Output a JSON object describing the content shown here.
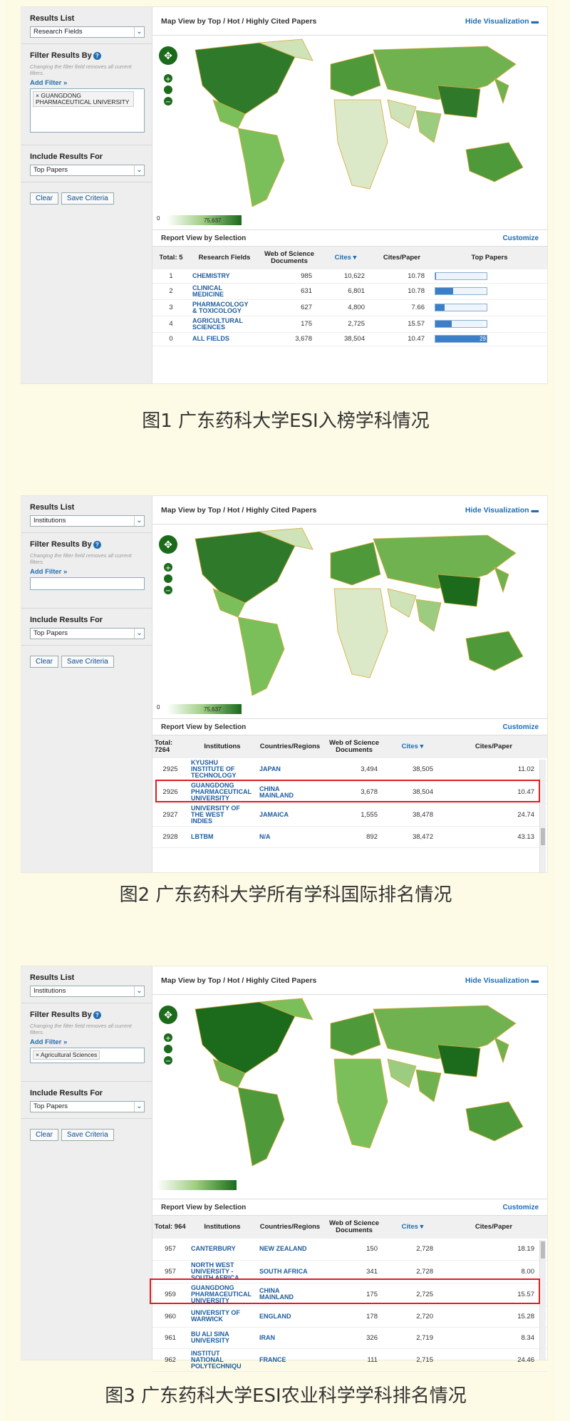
{
  "panels": [
    {
      "results_list": "Results List",
      "results_list_value": "Research Fields",
      "filter_title": "Filter Results By",
      "filter_note": "Changing the filter field removes all current filters.",
      "add_filter": "Add Filter »",
      "filter_tag": "GUANGDONG PHARMACEUTICAL UNIVERSITY",
      "include_title": "Include Results For",
      "include_value": "Top Papers",
      "clear": "Clear",
      "save": "Save Criteria",
      "map_title": "Map View by Top / Hot / Highly Cited Papers",
      "hide": "Hide Visualization",
      "legend_min": "0",
      "legend_max": "75,637",
      "report_title": "Report View by Selection",
      "customize": "Customize",
      "headers": [
        "Total: 5",
        "Research Fields",
        "Web of Science Documents",
        "Cites ▾",
        "Cites/Paper",
        "Top Papers"
      ],
      "rows": [
        {
          "rank": "1",
          "name": "CHEMISTRY",
          "docs": "985",
          "cites": "10,622",
          "cpp": "10.78",
          "tp": "0",
          "tpf": 0.02
        },
        {
          "rank": "2",
          "name": "CLINICAL MEDICINE",
          "docs": "631",
          "cites": "6,801",
          "cpp": "10.78",
          "tp": "7",
          "tpf": 0.35
        },
        {
          "rank": "3",
          "name": "PHARMACOLOGY & TOXICOLOGY",
          "docs": "627",
          "cites": "4,800",
          "cpp": "7.66",
          "tp": "2",
          "tpf": 0.18
        },
        {
          "rank": "4",
          "name": "AGRICULTURAL SCIENCES",
          "docs": "175",
          "cites": "2,725",
          "cpp": "15.57",
          "tp": "6",
          "tpf": 0.32
        },
        {
          "rank": "0",
          "name": "ALL FIELDS",
          "docs": "3,678",
          "cites": "38,504",
          "cpp": "10.47",
          "tp": "29",
          "tpf": 1.0
        }
      ],
      "caption": "图1  广东药科大学ESI入榜学科情况"
    },
    {
      "results_list": "Results List",
      "results_list_value": "Institutions",
      "filter_title": "Filter Results By",
      "filter_note": "Changing the filter field removes all current filters.",
      "add_filter": "Add Filter »",
      "include_title": "Include Results For",
      "include_value": "Top Papers",
      "clear": "Clear",
      "save": "Save Criteria",
      "map_title": "Map View by Top / Hot / Highly Cited Papers",
      "hide": "Hide Visualization",
      "legend_min": "0",
      "legend_max": "75,637",
      "report_title": "Report View by Selection",
      "customize": "Customize",
      "headers": [
        "Total: 7264",
        "Institutions",
        "Countries/Regions",
        "Web of Science Documents",
        "Cites ▾",
        "Cites/Paper"
      ],
      "rows": [
        {
          "rank": "2925",
          "name": "KYUSHU INSTITUTE OF TECHNOLOGY",
          "country": "JAPAN",
          "docs": "3,494",
          "cites": "38,505",
          "cpp": "11.02"
        },
        {
          "rank": "2926",
          "name": "GUANGDONG PHARMACEUTICAL UNIVERSITY",
          "country": "CHINA MAINLAND",
          "docs": "3,678",
          "cites": "38,504",
          "cpp": "10.47"
        },
        {
          "rank": "2927",
          "name": "UNIVERSITY OF THE WEST INDIES",
          "country": "JAMAICA",
          "docs": "1,555",
          "cites": "38,478",
          "cpp": "24.74"
        },
        {
          "rank": "2928",
          "name": "LBTBM",
          "country": "N/A",
          "docs": "892",
          "cites": "38,472",
          "cpp": "43.13"
        }
      ],
      "caption": "图2  广东药科大学所有学科国际排名情况"
    },
    {
      "results_list": "Results List",
      "results_list_value": "Institutions",
      "filter_title": "Filter Results By",
      "filter_note": "Changing the filter field removes all current filters.",
      "add_filter": "Add Filter »",
      "filter_tag": "Agricultural Sciences",
      "include_title": "Include Results For",
      "include_value": "Top Papers",
      "clear": "Clear",
      "save": "Save Criteria",
      "map_title": "Map View by Top / Hot / Highly Cited Papers",
      "hide": "Hide Visualization",
      "report_title": "Report View by Selection",
      "customize": "Customize",
      "headers": [
        "Total: 964",
        "Institutions",
        "Countries/Regions",
        "Web of Science Documents",
        "Cites ▾",
        "Cites/Paper"
      ],
      "rows": [
        {
          "rank": "957",
          "name": "CANTERBURY",
          "country": "NEW ZEALAND",
          "docs": "150",
          "cites": "2,728",
          "cpp": "18.19"
        },
        {
          "rank": "957",
          "name": "NORTH WEST UNIVERSITY - SOUTH AFRICA",
          "country": "SOUTH AFRICA",
          "docs": "341",
          "cites": "2,728",
          "cpp": "8.00"
        },
        {
          "rank": "959",
          "name": "GUANGDONG PHARMACEUTICAL UNIVERSITY",
          "country": "CHINA MAINLAND",
          "docs": "175",
          "cites": "2,725",
          "cpp": "15.57"
        },
        {
          "rank": "960",
          "name": "UNIVERSITY OF WARWICK",
          "country": "ENGLAND",
          "docs": "178",
          "cites": "2,720",
          "cpp": "15.28"
        },
        {
          "rank": "961",
          "name": "BU ALI SINA UNIVERSITY",
          "country": "IRAN",
          "docs": "326",
          "cites": "2,719",
          "cpp": "8.34"
        },
        {
          "rank": "962",
          "name": "INSTITUT NATIONAL POLYTECHNIQU",
          "country": "FRANCE",
          "docs": "111",
          "cites": "2,715",
          "cpp": "24.46"
        }
      ],
      "caption": "图3 广东药科大学ESI农业科学学科排名情况"
    }
  ]
}
